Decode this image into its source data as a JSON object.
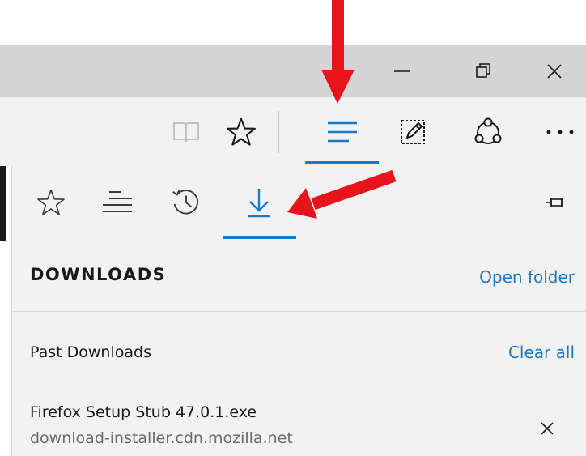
{
  "window_controls": {
    "minimize_icon": "minimize-icon",
    "restore_icon": "restore-icon",
    "close_icon": "close-icon"
  },
  "toolbar": {
    "icons": [
      "reading-view-icon",
      "favorite-star-icon",
      "hub-icon",
      "web-note-icon",
      "share-icon",
      "more-icon"
    ],
    "active": "hub-icon"
  },
  "hub": {
    "tabs": [
      "favorites-icon",
      "reading-list-icon",
      "history-icon",
      "downloads-icon"
    ],
    "active_tab": "downloads-icon",
    "pin_icon": "pin-icon"
  },
  "downloads": {
    "title": "DOWNLOADS",
    "open_folder": "Open folder",
    "past_label": "Past Downloads",
    "clear_all": "Clear all",
    "items": [
      {
        "name": "Firefox Setup Stub 47.0.1.exe",
        "source": "download-installer.cdn.mozilla.net"
      }
    ]
  },
  "colors": {
    "accent": "#1979ca",
    "annotation": "#e8141b",
    "titlebar": "#d4d4d4",
    "toolbar": "#f2f2f2"
  }
}
